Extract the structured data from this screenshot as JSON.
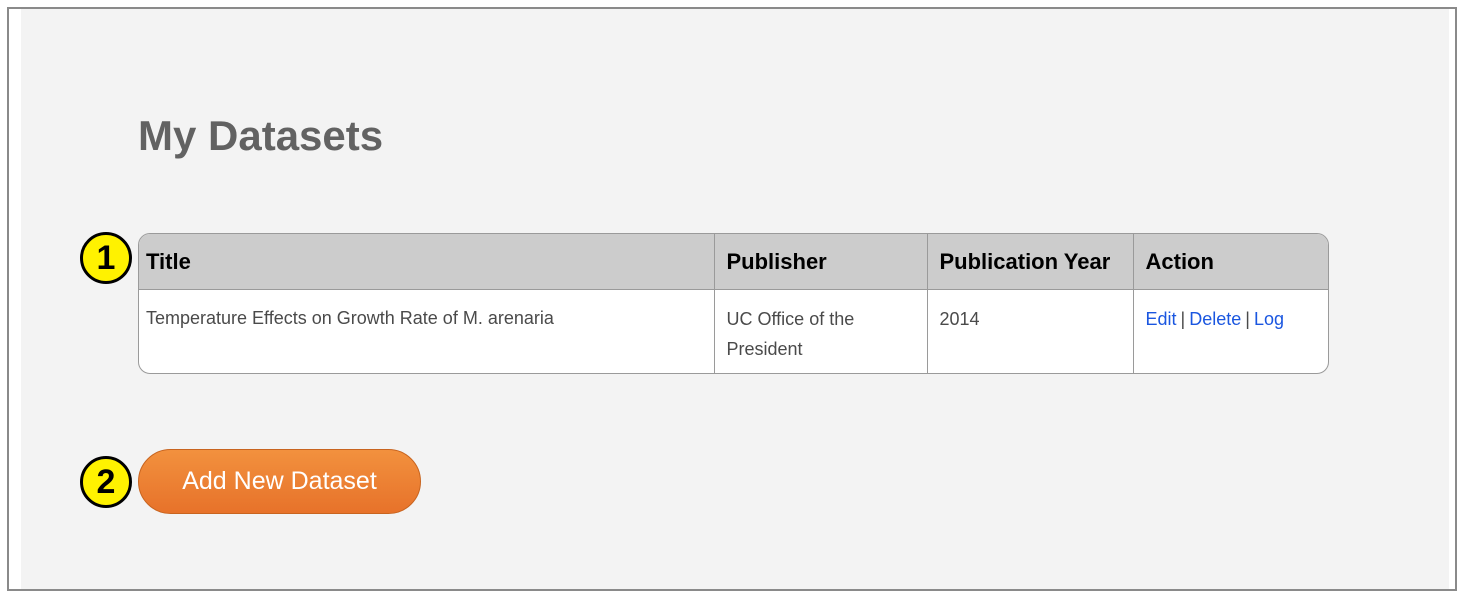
{
  "page": {
    "title": "My Datasets"
  },
  "callouts": {
    "one": "1",
    "two": "2"
  },
  "table": {
    "headers": {
      "title": "Title",
      "publisher": "Publisher",
      "year": "Publication Year",
      "action": "Action"
    },
    "rows": [
      {
        "title": "Temperature Effects on Growth Rate of M. arenaria",
        "publisher": "UC Office of the President",
        "year": "2014",
        "actions": {
          "edit": "Edit",
          "delete": "Delete",
          "log": "Log",
          "separator": "|"
        }
      }
    ]
  },
  "add_button": {
    "label": "Add New Dataset"
  },
  "colors": {
    "accent_button": "#ed7f33",
    "link": "#1a56e0",
    "callout_fill": "#fff200",
    "header_bg": "#cccccc",
    "panel_bg": "#f3f3f3"
  }
}
